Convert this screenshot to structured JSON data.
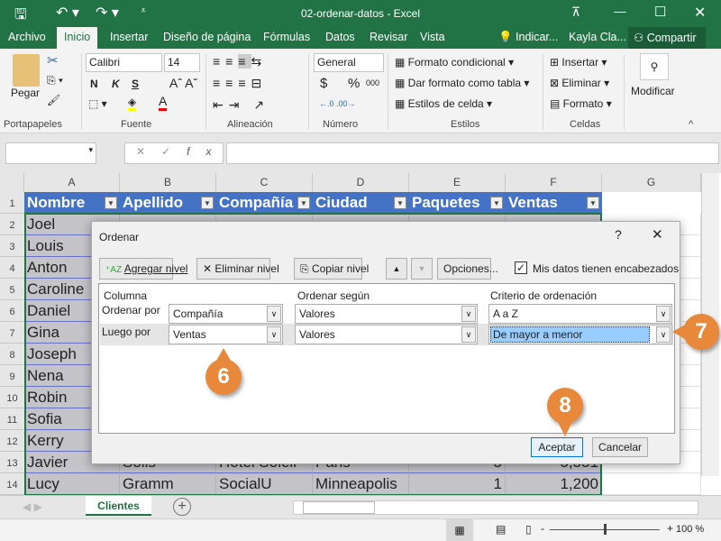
{
  "title": "02-ordenar-datos  -  Excel",
  "tabs": [
    "Archivo",
    "Inicio",
    "Insertar",
    "Diseño de página",
    "Fórmulas",
    "Datos",
    "Revisar",
    "Vista"
  ],
  "tell_me": "Indicar...",
  "user": "Kayla Cla...",
  "share": "Compartir",
  "ribbon": {
    "paste": "Pegar",
    "font": "Calibri",
    "size": "14",
    "number_format": "General",
    "cond_format": "Formato condicional",
    "table_format": "Dar formato como tabla",
    "cell_styles": "Estilos de celda",
    "insert": "Insertar",
    "delete": "Eliminar",
    "format": "Formato",
    "modify": "Modificar",
    "bold": "N",
    "italic": "K",
    "underline": "S",
    "currency": "$",
    "percent": "%",
    "thousands": "000",
    "groups": [
      "Portapapeles",
      "Fuente",
      "Alineación",
      "Número",
      "Estilos",
      "Celdas"
    ]
  },
  "formula_bar": {
    "fx": "fx",
    "cancel": "✕",
    "enter": "✓"
  },
  "columns": [
    "A",
    "B",
    "C",
    "D",
    "E",
    "F",
    "G"
  ],
  "header_row": [
    "Nombre",
    "Apellido",
    "Compañía",
    "Ciudad",
    "Paquetes",
    "Ventas"
  ],
  "first_names": [
    "Joel",
    "Louis",
    "Anton",
    "Caroline",
    "Daniel",
    "Gina",
    "Joseph",
    "Nena",
    "Robin",
    "Sofia",
    "Kerry",
    "Javier",
    "Lucy"
  ],
  "row13": [
    "Javier",
    "Solis",
    "Hotel Soleil",
    "Paris",
    "5",
    "5,551"
  ],
  "row14": [
    "Lucy",
    "Gramm",
    "SocialU",
    "Minneapolis",
    "1",
    "1,200"
  ],
  "sheet_tab": "Clientes",
  "zoom": "100 %",
  "zoom_percent": 100,
  "dialog": {
    "title": "Ordenar",
    "help": "?",
    "close": "✕",
    "add_level": "Agregar nivel",
    "delete_level": "Eliminar nivel",
    "copy_level": "Copiar nivel",
    "options": "Opciones...",
    "has_headers": "Mis datos tienen encabezados",
    "has_headers_checked": true,
    "col_headers": [
      "Columna",
      "Ordenar según",
      "Criterio de ordenación"
    ],
    "rows": [
      {
        "label": "Ordenar por",
        "column": "Compañía",
        "sort_on": "Valores",
        "order": "A a Z"
      },
      {
        "label": "Luego por",
        "column": "Ventas",
        "sort_on": "Valores",
        "order": "De mayor a menor"
      }
    ],
    "ok": "Aceptar",
    "cancel": "Cancelar"
  },
  "badges": [
    "6",
    "7",
    "8"
  ],
  "colors": {
    "excel_green": "#217346",
    "table_header": "#4472c4",
    "badge": "#e8883a",
    "selection": "#99ccff"
  }
}
